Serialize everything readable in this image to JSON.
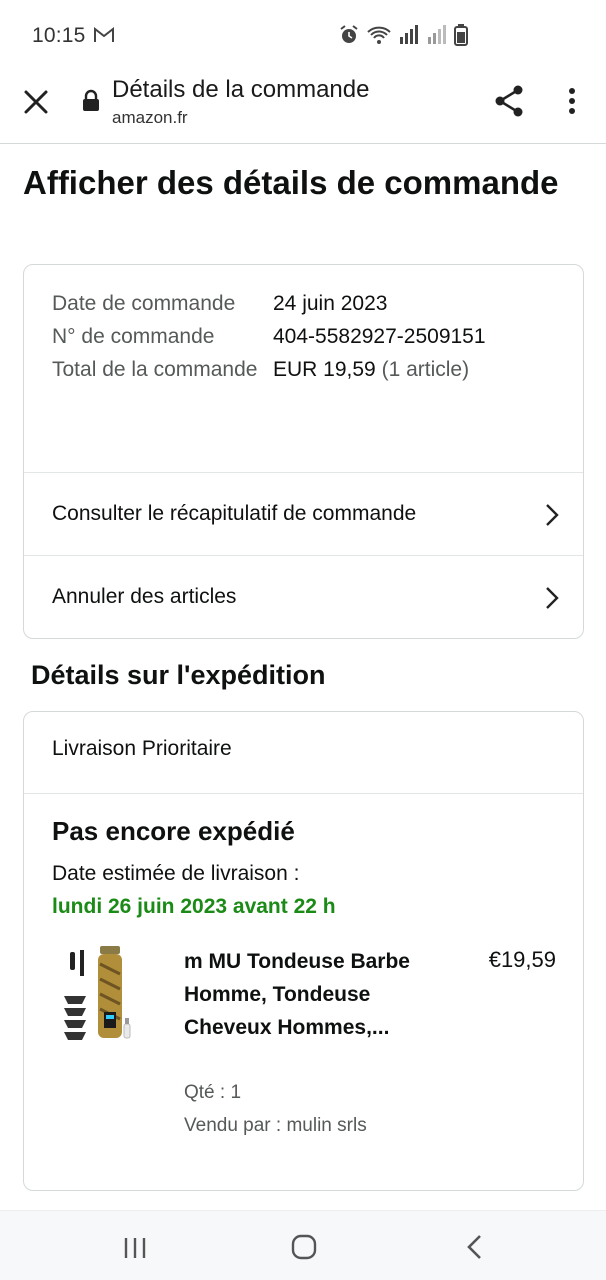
{
  "status_bar": {
    "time": "10:15",
    "icons": [
      "gmail-icon",
      "alarm-icon",
      "wifi-icon",
      "signal-icon",
      "signal-icon",
      "battery-icon"
    ]
  },
  "browser": {
    "title": "Détails de la commande",
    "domain": "amazon.fr"
  },
  "page": {
    "heading": "Afficher des détails de commande"
  },
  "order_info": {
    "date_label": "Date de commande",
    "date_value": "24 juin 2023",
    "number_label": "N° de commande",
    "number_value": "404-5582927-2509151",
    "total_label": "Total de la commande",
    "total_value": "EUR 19,59",
    "total_count": "(1 article)"
  },
  "links": {
    "recap": "Consulter le récapitulatif de commande",
    "cancel": "Annuler des articles"
  },
  "shipping": {
    "section_title": "Détails sur l'expédition",
    "method": "Livraison Prioritaire",
    "status": "Pas encore expédié",
    "estimate_label": "Date estimée de livraison :",
    "estimate_date": "lundi 26 juin 2023 avant 22 h"
  },
  "product": {
    "name": "m MU Tondeuse Barbe Homme, Tondeuse Cheveux Hommes,...",
    "price": "€19,59",
    "qty": "Qté : 1",
    "seller": "Vendu par : mulin srls"
  },
  "colors": {
    "accent_green": "#1b8a16",
    "border": "#d5d9d9",
    "muted_text": "#565959"
  }
}
